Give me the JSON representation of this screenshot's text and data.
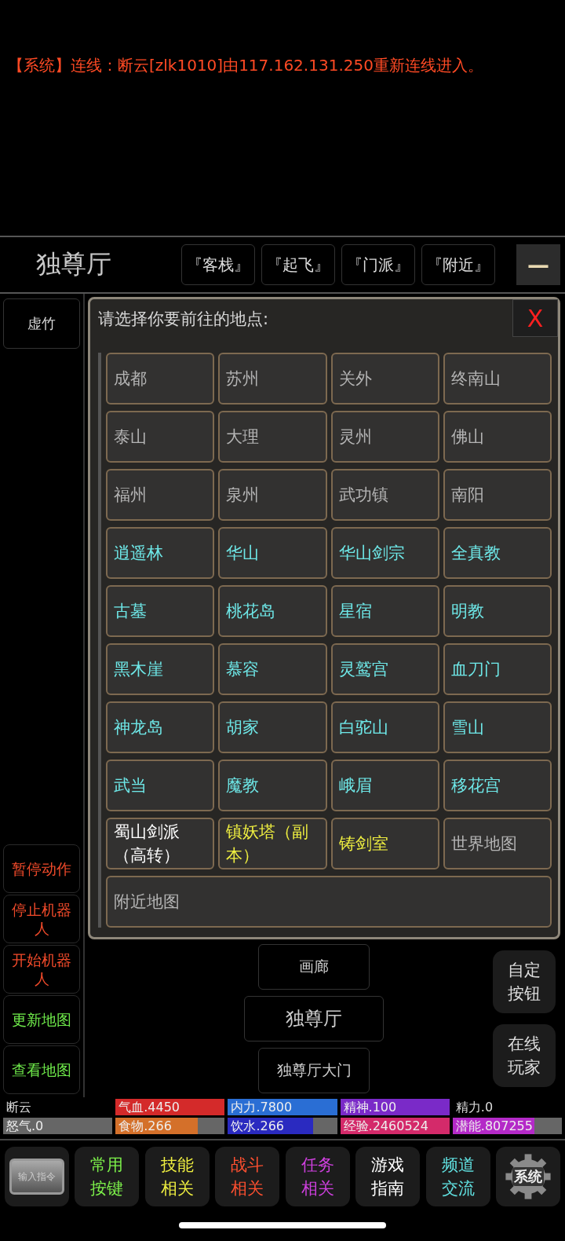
{
  "message": "【系统】连线：断云[zlk1010]由117.162.131.250重新连线进入。",
  "room": {
    "title": "独尊厅",
    "shortcuts": [
      "『客栈』",
      "『起飞』",
      "『门派』",
      "『附近』"
    ],
    "menu": "—"
  },
  "left_panel": {
    "npcs": [
      "虚竹"
    ],
    "actions": [
      {
        "label": "暂停动作",
        "color": "#f04a2a"
      },
      {
        "label": "停止机器人",
        "color": "#f04a2a"
      },
      {
        "label": "开始机器人",
        "color": "#f04a2a"
      },
      {
        "label": "更新地图",
        "color": "#6ee84a"
      },
      {
        "label": "查看地图",
        "color": "#6ee84a"
      }
    ]
  },
  "dialog": {
    "title": "请选择你要前往的地点:",
    "close": "X",
    "locations": [
      {
        "label": "成都",
        "color": "#b4b4b4"
      },
      {
        "label": "苏州",
        "color": "#b4b4b4"
      },
      {
        "label": "关外",
        "color": "#b4b4b4"
      },
      {
        "label": "终南山",
        "color": "#b4b4b4"
      },
      {
        "label": "泰山",
        "color": "#b4b4b4"
      },
      {
        "label": "大理",
        "color": "#b4b4b4"
      },
      {
        "label": "灵州",
        "color": "#b4b4b4"
      },
      {
        "label": "佛山",
        "color": "#b4b4b4"
      },
      {
        "label": "福州",
        "color": "#b4b4b4"
      },
      {
        "label": "泉州",
        "color": "#b4b4b4"
      },
      {
        "label": "武功镇",
        "color": "#b4b4b4"
      },
      {
        "label": "南阳",
        "color": "#b4b4b4"
      },
      {
        "label": "逍遥林",
        "color": "#6ee8e8"
      },
      {
        "label": "华山",
        "color": "#6ee8e8"
      },
      {
        "label": "华山剑宗",
        "color": "#6ee8e8"
      },
      {
        "label": "全真教",
        "color": "#6ee8e8"
      },
      {
        "label": "古墓",
        "color": "#6ee8e8"
      },
      {
        "label": "桃花岛",
        "color": "#6ee8e8"
      },
      {
        "label": "星宿",
        "color": "#6ee8e8"
      },
      {
        "label": "明教",
        "color": "#6ee8e8"
      },
      {
        "label": "黑木崖",
        "color": "#6ee8e8"
      },
      {
        "label": "慕容",
        "color": "#6ee8e8"
      },
      {
        "label": "灵鹫宫",
        "color": "#6ee8e8"
      },
      {
        "label": "血刀门",
        "color": "#6ee8e8"
      },
      {
        "label": "神龙岛",
        "color": "#6ee8e8"
      },
      {
        "label": "胡家",
        "color": "#6ee8e8"
      },
      {
        "label": "白驼山",
        "color": "#6ee8e8"
      },
      {
        "label": "雪山",
        "color": "#6ee8e8"
      },
      {
        "label": "武当",
        "color": "#6ee8e8"
      },
      {
        "label": "魔教",
        "color": "#6ee8e8"
      },
      {
        "label": "峨眉",
        "color": "#6ee8e8"
      },
      {
        "label": "移花宫",
        "color": "#6ee8e8"
      },
      {
        "label": "蜀山剑派（高转）",
        "color": "#ffffff"
      },
      {
        "label": "镇妖塔（副本）",
        "color": "#f0f040"
      },
      {
        "label": "铸剑室",
        "color": "#f0f040"
      },
      {
        "label": "世界地图",
        "color": "#b4b4b4"
      },
      {
        "label": "附近地图",
        "color": "#b4b4b4",
        "wide": true
      }
    ]
  },
  "exits": [
    "画廊",
    "独尊厅",
    "独尊厅大门"
  ],
  "side_buttons": [
    "自定按钮",
    "在线玩家"
  ],
  "status": [
    [
      {
        "kind": "text",
        "label": "断云"
      },
      {
        "kind": "bar",
        "label": "气血.4450",
        "color": "#d42a2a",
        "level": 1
      },
      {
        "kind": "bar",
        "label": "内力.7800",
        "color": "#2a6ed4",
        "level": 1
      },
      {
        "kind": "bar",
        "label": "精神.100",
        "color": "#7a2ac8",
        "level": 1
      },
      {
        "kind": "text",
        "label": "精力.0"
      }
    ],
    [
      {
        "kind": "bar",
        "label": "怒气.0"
      },
      {
        "kind": "bar",
        "label": "食物.266",
        "color": "#d4702a",
        "level": 0.75
      },
      {
        "kind": "bar",
        "label": "饮水.266",
        "color": "#2a2ac0",
        "level": 0.78
      },
      {
        "kind": "bar",
        "label": "经验.2460524",
        "color": "#d42a6a",
        "level": 1
      },
      {
        "kind": "bar",
        "label": "潜能.807255",
        "color": "#b42ac8",
        "level": 0.75
      }
    ]
  ],
  "nav": [
    {
      "kind": "image",
      "lines": [
        "输入指令"
      ]
    },
    {
      "kind": "text",
      "lines": [
        "常用",
        "按键"
      ],
      "color": "#7cf04a"
    },
    {
      "kind": "text",
      "lines": [
        "技能",
        "相关"
      ],
      "color": "#f0f040"
    },
    {
      "kind": "text",
      "lines": [
        "战斗",
        "相关"
      ],
      "color": "#ff5030"
    },
    {
      "kind": "text",
      "lines": [
        "任务",
        "相关"
      ],
      "color": "#d040e0"
    },
    {
      "kind": "text",
      "lines": [
        "游戏",
        "指南"
      ],
      "color": "#ffffff"
    },
    {
      "kind": "text",
      "lines": [
        "频道",
        "交流"
      ],
      "color": "#60e0e0"
    },
    {
      "kind": "gear",
      "lines": [
        "系统"
      ]
    }
  ]
}
